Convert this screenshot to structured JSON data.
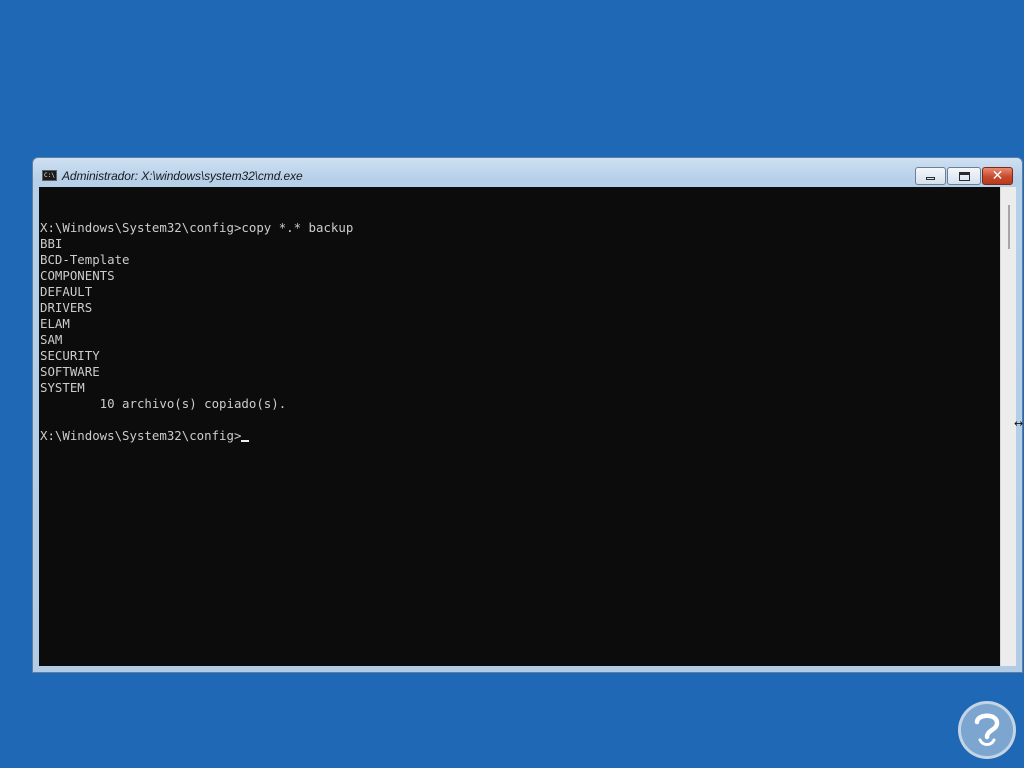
{
  "window": {
    "title": "Administrador: X:\\windows\\system32\\cmd.exe",
    "app_icon_text": "C:\\"
  },
  "controls": {
    "minimize_icon": "minimize-icon",
    "maximize_icon": "maximize-icon",
    "close_icon": "close-icon",
    "close_glyph": "✕"
  },
  "console": {
    "lines": [
      "",
      "X:\\Windows\\System32\\config>copy *.* backup",
      "BBI",
      "BCD-Template",
      "COMPONENTS",
      "DEFAULT",
      "DRIVERS",
      "ELAM",
      "SAM",
      "SECURITY",
      "SOFTWARE",
      "SYSTEM",
      "        10 archivo(s) copiado(s).",
      ""
    ],
    "prompt": "X:\\Windows\\System32\\config>"
  },
  "colors": {
    "desktop": "#1f68b5",
    "console_bg": "#0c0c0c",
    "console_fg": "#cccccc",
    "close_button": "#c74a2c"
  },
  "watermark_icon": "question-mark-logo"
}
